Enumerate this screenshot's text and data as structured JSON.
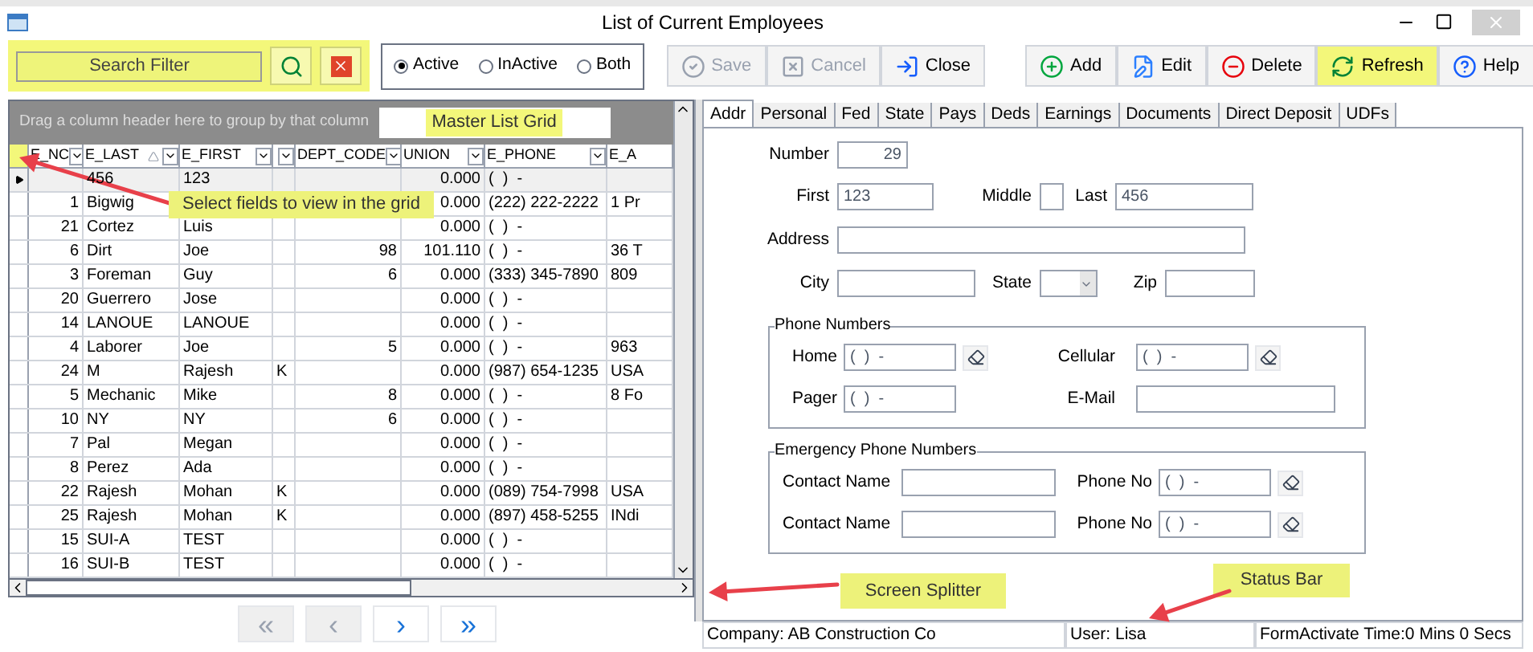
{
  "window": {
    "title": "List of Current Employees"
  },
  "search": {
    "placeholder": "Search Filter",
    "highlighted": true
  },
  "status_filter": [
    {
      "label": "Active",
      "selected": true
    },
    {
      "label": "InActive",
      "selected": false
    },
    {
      "label": "Both",
      "selected": false
    }
  ],
  "toolbar": [
    {
      "kind": "save",
      "label": "Save",
      "disabled": true,
      "highlighted": false
    },
    {
      "kind": "cancel",
      "label": "Cancel",
      "disabled": true,
      "highlighted": false
    },
    {
      "kind": "close",
      "label": "Close",
      "disabled": false,
      "highlighted": false
    },
    {
      "kind": "add",
      "label": "Add",
      "disabled": false,
      "highlighted": false
    },
    {
      "kind": "edit",
      "label": "Edit",
      "disabled": false,
      "highlighted": false
    },
    {
      "kind": "delete",
      "label": "Delete",
      "disabled": false,
      "highlighted": false
    },
    {
      "kind": "refresh",
      "label": "Refresh",
      "disabled": false,
      "highlighted": true
    },
    {
      "kind": "help",
      "label": "Help",
      "disabled": false,
      "highlighted": false
    }
  ],
  "grid": {
    "group_hint": "Drag a column header here to group by that column",
    "label": "Master List Grid",
    "columns": [
      {
        "label": "E_NC",
        "sorted": false
      },
      {
        "label": "E_LAST",
        "sorted": true
      },
      {
        "label": "E_FIRST",
        "sorted": false
      },
      {
        "sorted": false
      },
      {
        "label": "DEPT_CODE",
        "sorted": false
      },
      {
        "label": "UNION",
        "sorted": false
      },
      {
        "label": "E_PHONE",
        "sorted": false
      },
      {
        "label": "E_A",
        "sorted": false
      }
    ],
    "rows": [
      {
        "selected": true,
        "e_last": "456",
        "e_first": "123",
        "union": "0.000",
        "e_phone": "(  )  -"
      },
      {
        "selected": false,
        "e_no": "1",
        "e_last": "Bigwig",
        "union": "0.000",
        "e_phone": "(222) 222-2222",
        "column_8": "1 Pr"
      },
      {
        "selected": false,
        "e_no": "21",
        "e_last": "Cortez",
        "e_first": "Luis",
        "union": "0.000",
        "e_phone": "(  )  -"
      },
      {
        "selected": false,
        "e_no": "6",
        "e_last": "Dirt",
        "e_first": "Joe",
        "dept_code": "98",
        "union": "101.110",
        "e_phone": "(  )  -",
        "column_8": "36 T"
      },
      {
        "selected": false,
        "e_no": "3",
        "e_last": "Foreman",
        "e_first": "Guy",
        "dept_code": "6",
        "union": "0.000",
        "e_phone": "(333) 345-7890",
        "column_8": "809"
      },
      {
        "selected": false,
        "e_no": "20",
        "e_last": "Guerrero",
        "e_first": "Jose",
        "union": "0.000",
        "e_phone": "(  )  -"
      },
      {
        "selected": false,
        "e_no": "14",
        "e_last": "LANOUE",
        "e_first": "LANOUE",
        "union": "0.000",
        "e_phone": "(  )  -"
      },
      {
        "selected": false,
        "e_no": "4",
        "e_last": "Laborer",
        "e_first": "Joe",
        "dept_code": "5",
        "union": "0.000",
        "e_phone": "(  )  -",
        "column_8": "963"
      },
      {
        "selected": false,
        "e_no": "24",
        "e_last": "M",
        "e_first": "Rajesh",
        "column_4": "K",
        "union": "0.000",
        "e_phone": "(987) 654-1235",
        "column_8": "USA"
      },
      {
        "selected": false,
        "e_no": "5",
        "e_last": "Mechanic",
        "e_first": "Mike",
        "dept_code": "8",
        "union": "0.000",
        "e_phone": "(  )  -",
        "column_8": "8 Fo"
      },
      {
        "selected": false,
        "e_no": "10",
        "e_last": "NY",
        "e_first": "NY",
        "dept_code": "6",
        "union": "0.000",
        "e_phone": "(  )  -"
      },
      {
        "selected": false,
        "e_no": "7",
        "e_last": "Pal",
        "e_first": "Megan",
        "union": "0.000",
        "e_phone": "(  )  -"
      },
      {
        "selected": false,
        "e_no": "8",
        "e_last": "Perez",
        "e_first": "Ada",
        "union": "0.000",
        "e_phone": "(  )  -"
      },
      {
        "selected": false,
        "e_no": "22",
        "e_last": "Rajesh",
        "e_first": "Mohan",
        "column_4": "K",
        "union": "0.000",
        "e_phone": "(089) 754-7998",
        "column_8": "USA"
      },
      {
        "selected": false,
        "e_no": "25",
        "e_last": "Rajesh",
        "e_first": "Mohan",
        "column_4": "K",
        "union": "0.000",
        "e_phone": "(897) 458-5255",
        "column_8": "INdi"
      },
      {
        "selected": false,
        "e_no": "15",
        "e_last": "SUI-A",
        "e_first": "TEST",
        "union": "0.000",
        "e_phone": "(  )  -"
      },
      {
        "selected": false,
        "e_no": "16",
        "e_last": "SUI-B",
        "e_first": "TEST",
        "union": "0.000",
        "e_phone": "(  )  -"
      }
    ]
  },
  "pager": [
    {
      "label": "«",
      "disabled": true
    },
    {
      "label": "‹",
      "disabled": true
    },
    {
      "label": "›",
      "disabled": false
    },
    {
      "label": "»",
      "disabled": false
    }
  ],
  "tabs": [
    {
      "label": "Addr",
      "selected": true
    },
    {
      "label": "Personal",
      "selected": false
    },
    {
      "label": "Fed",
      "selected": false
    },
    {
      "label": "State",
      "selected": false
    },
    {
      "label": "Pays",
      "selected": false
    },
    {
      "label": "Deds",
      "selected": false
    },
    {
      "label": "Earnings",
      "selected": false
    },
    {
      "label": "Documents",
      "selected": false
    },
    {
      "label": "Direct Deposit",
      "selected": false
    },
    {
      "label": "UDFs",
      "selected": false
    }
  ],
  "form": {
    "number": {
      "label": "Number",
      "value": "29"
    },
    "first": {
      "label": "First",
      "value": "123"
    },
    "middle": {
      "label": "Middle"
    },
    "last": {
      "label": "Last",
      "value": "456"
    },
    "address": {
      "label": "Address"
    },
    "city": {
      "label": "City"
    },
    "state": {
      "label": "State"
    },
    "zip": {
      "label": "Zip"
    },
    "phone_numbers": {
      "title": "Phone Numbers",
      "home": {
        "label": "Home",
        "value": "(  )  -"
      },
      "cellular": {
        "label": "Cellular",
        "value": "(  )  -"
      },
      "pager": {
        "label": "Pager",
        "value": "(  )  -"
      },
      "email": {
        "label": "E-Mail"
      }
    },
    "emergency": {
      "title": "Emergency Phone Numbers",
      "contacts": [
        {
          "name_label": "Contact Name",
          "phone_label": "Phone No",
          "phone": "(  )  -"
        },
        {
          "name_label": "Contact Name",
          "phone_label": "Phone No",
          "phone": "(  )  -"
        }
      ]
    }
  },
  "status_bar": [
    "Company: AB Construction Co",
    "User: Lisa",
    "FormActivate Time:0 Mins 0 Secs"
  ],
  "callouts": [
    {
      "text": "Select fields to view in the grid"
    },
    {
      "text": "Screen Splitter"
    },
    {
      "text": "Status Bar"
    }
  ]
}
